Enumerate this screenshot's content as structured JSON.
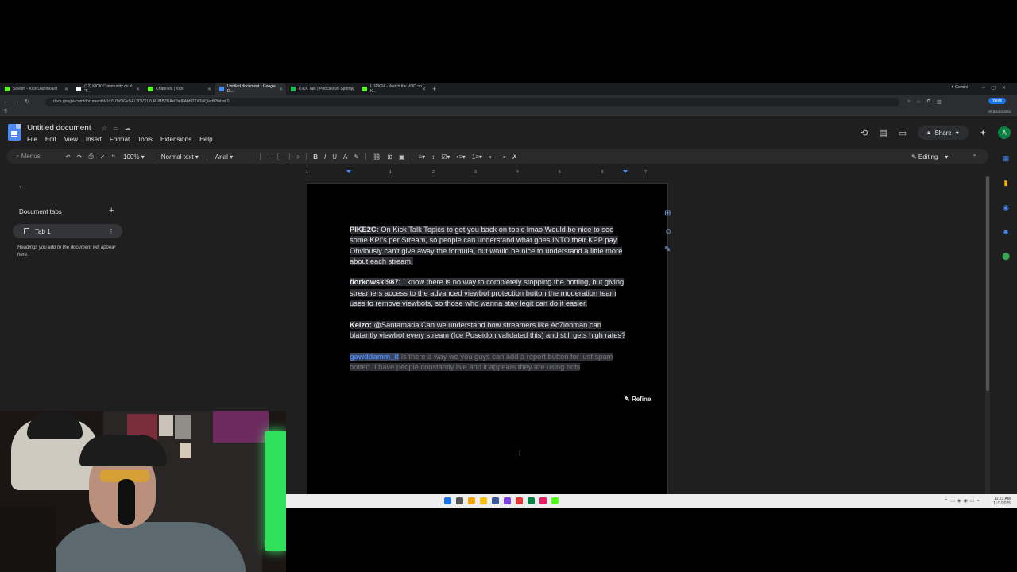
{
  "browser": {
    "tabs": [
      {
        "label": "Stream - Kick Dashboard",
        "color": "#53fc18"
      },
      {
        "label": "(12) KICK Community on X: \"F...",
        "color": "#ffffff"
      },
      {
        "label": "Channels | Kick",
        "color": "#53fc18"
      },
      {
        "label": "Untitled document - Google D...",
        "color": "#4a8af4",
        "active": true
      },
      {
        "label": "KICK Talk | Podcast on Spotify",
        "color": "#1db954"
      },
      {
        "label": "LURK24 - Watch the VOD on K...",
        "color": "#53fc18"
      }
    ],
    "gemini_label": "Gemini",
    "url": "docs.google.com/document/d/1nZUTa5lGeSAL2DVX1ZuR1MBZUAv09eIFAbhl22XTaiQ/edit?tab=t.0",
    "work_badge": "Work",
    "all_bookmarks": "All Bookmarks"
  },
  "docs": {
    "title": "Untitled document",
    "menu": [
      "File",
      "Edit",
      "View",
      "Insert",
      "Format",
      "Tools",
      "Extensions",
      "Help"
    ],
    "share_label": "Share",
    "avatar_initial": "A",
    "toolbar": {
      "menus_placeholder": "Menus",
      "zoom": "100%",
      "style": "Normal text",
      "font": "Arial",
      "mode": "Editing"
    },
    "ruler": [
      "1",
      "1",
      "2",
      "3",
      "4",
      "5",
      "6",
      "7"
    ],
    "left_panel": {
      "heading": "Document tabs",
      "tab_name": "Tab 1",
      "hint": "Headings you add to the document will appear here."
    },
    "paragraphs": [
      {
        "user": "PIKE2C:",
        "text": " On Kick Talk Topics to get you back on topic lmao Would be nice to see some KPI's per Stream, so people can understand what goes INTO their KPP pay. Obviously can't give away the formula, but would be nice to understand a little more about each stream."
      },
      {
        "user": "florkowski987:",
        "text": " I know there is no way to completely stopping the botting, but giving streamers access to the advanced viewbot protection button the moderation team uses to remove viewbots, so those who wanna stay legit can do it easier."
      },
      {
        "user": "Kelzo:",
        "text": " @Santamaria Can we understand how streamers like Ac7ionman can blatantly viewbot every stream (Ice Poseidon validated this) and still gets high rates?"
      }
    ],
    "selected_paragraph": {
      "user": "gawddamm_it",
      "text": " Is there a way we you guys can add a report button for just spam botted. I have people constantly live and it appears they are using bots"
    },
    "refine_label": "Refine"
  },
  "taskbar": {
    "time": "11:21 AM",
    "date": "11/1/2025",
    "icon_colors": [
      "#1a73e8",
      "#555555",
      "#f0a500",
      "#f4c20d",
      "#3b5998",
      "#7b3fe4",
      "#e53935",
      "#0b8043",
      "#e91e63",
      "#53fc18"
    ]
  }
}
